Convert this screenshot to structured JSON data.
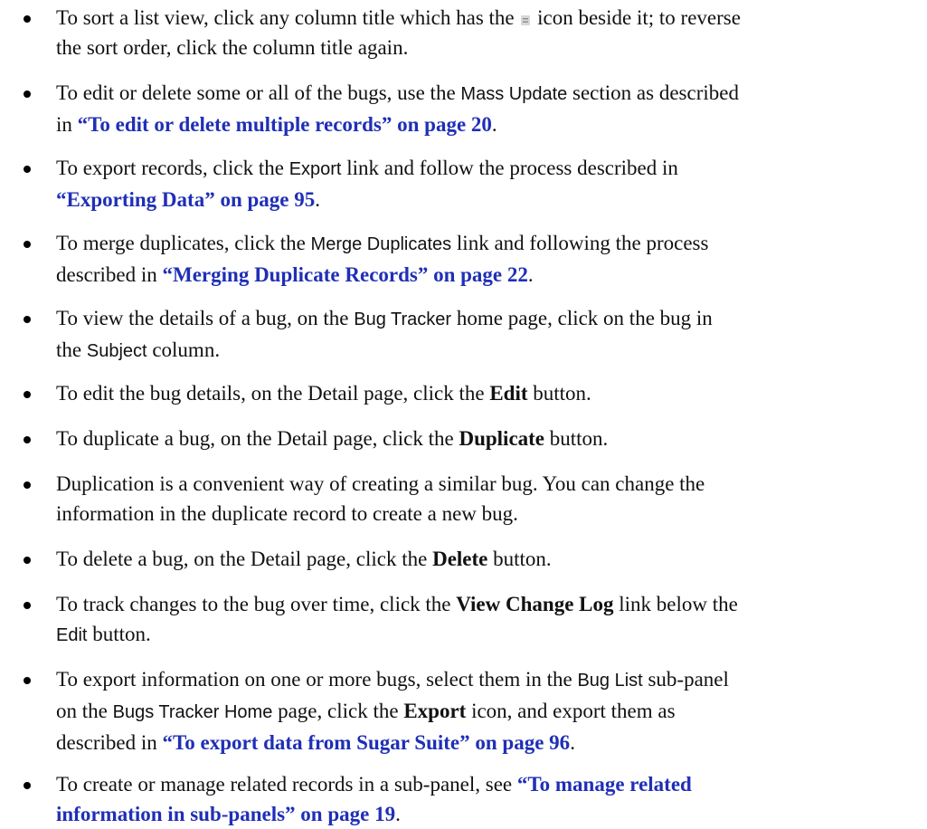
{
  "items": [
    {
      "l1a": "To sort a list view, click any column title which has the",
      "l1b": "icon beside it; to reverse",
      "l2": "the sort order, click the column title again."
    },
    {
      "l1a": "To edit or delete some or all of the bugs, use the",
      "l1b": "Mass Update",
      "l1c": "section as described",
      "l2a": "in",
      "l2b": "“To edit or delete multiple records” on page 20",
      "l2c": "."
    },
    {
      "l1a": "To export records, click the",
      "l1b": "Export",
      "l1c": "link and follow the process described in",
      "l2a": "“Exporting Data” on page 95",
      "l2b": "."
    },
    {
      "l1a": "To merge duplicates, click the",
      "l1b": "Merge Duplicates",
      "l1c": "link and following the process",
      "l2a": "described in",
      "l2b": "“Merging Duplicate Records” on page 22",
      "l2c": "."
    },
    {
      "l1a": "To view the details of a bug, on the",
      "l1b": "Bug Tracker",
      "l1c": "home page, click on the bug in",
      "l2a": "the",
      "l2b": "Subject",
      "l2c": "column."
    },
    {
      "l1a": "To edit the bug details, on the Detail page, click the",
      "l1b": "Edit",
      "l1c": "button."
    },
    {
      "l1a": "To duplicate a bug, on the Detail page, click the",
      "l1b": "Duplicate",
      "l1c": "button."
    },
    {
      "l1": "Duplication is a convenient way of creating a similar bug. You can change the",
      "l2": "information in the duplicate record to create a new bug."
    },
    {
      "l1a": "To delete a bug, on the Detail page, click the",
      "l1b": "Delete",
      "l1c": "button."
    },
    {
      "l1a": "To track changes to the bug over time, click the",
      "l1b": "View Change Log",
      "l1c": "link below the",
      "l2a": "Edit",
      "l2b": "button."
    },
    {
      "l1a": "To export information on one or more bugs, select them in the",
      "l1b": "Bug List",
      "l1c": "sub-panel",
      "l2a": "on the",
      "l2b": "Bugs Tracker Home",
      "l2c": "page, click the",
      "l2d": "Export",
      "l2e": "icon, and export them as",
      "l3a": "described in",
      "l3b": "“To export data from Sugar Suite” on page 96",
      "l3c": "."
    },
    {
      "l1a": "To create or manage related records in a sub-panel, see",
      "l1b": "“To manage related",
      "l2a": "information in sub-panels” on page 19",
      "l2b": "."
    }
  ],
  "colors": {
    "link": "#1f2fb6",
    "text": "#111111"
  },
  "icons": {
    "sort": "sort-icon"
  }
}
